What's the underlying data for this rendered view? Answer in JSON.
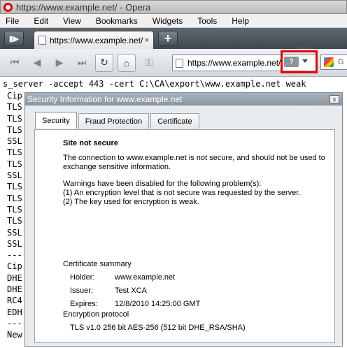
{
  "window": {
    "title": "https://www.example.net/ - Opera"
  },
  "menu": [
    "File",
    "Edit",
    "View",
    "Bookmarks",
    "Widgets",
    "Tools",
    "Help"
  ],
  "tabs": {
    "active_label": "https://www.example.net/",
    "close_glyph": "×",
    "new_tab_glyph": "+"
  },
  "toolbar": {
    "address": "https://www.example.net/",
    "search_label": "G",
    "security_badge": "?"
  },
  "page": {
    "command": "s_server -accept 443 -cert C:\\CA\\export\\www.example.net weak",
    "lines": [
      "Cip",
      "TLS",
      "TLS",
      "TLS",
      "SSL",
      "TLS",
      "TLS",
      "SSL",
      "TLS",
      "TLS",
      "TLS",
      "TLS",
      "SSL",
      "SSL",
      "---",
      "Cip",
      "DHE",
      "DHE",
      "RC4",
      "EDH",
      "---",
      "New"
    ]
  },
  "dialog": {
    "title": "Security Information for www.example.net",
    "close_glyph": "x",
    "tabs": [
      "Security",
      "Fraud Protection",
      "Certificate"
    ],
    "heading": "Site not secure",
    "intro": "The connection to www.example.net is not secure, and should not be used to exchange sensitive information.",
    "warning_lead": "Warnings have been disabled for the following problem(s):",
    "warning_1": "(1) An encryption level that is not secure was requested by the server.",
    "warning_2": "(2) The key used for encryption is weak.",
    "cert_summary_title": "Certificate summary",
    "holder_label": "Holder:",
    "holder_value": "www.example.net",
    "issuer_label": "Issuer:",
    "issuer_value": "Test XCA",
    "expires_label": "Expires:",
    "expires_value": "12/8/2010 14:25:00 GMT",
    "enc_title": "Encryption protocol",
    "enc_value": "TLS v1.0 256 bit AES-256 (512 bit DHE_RSA/SHA)"
  },
  "colors": {
    "highlight_box": "#e00000",
    "tabbar": "#4a535b"
  }
}
